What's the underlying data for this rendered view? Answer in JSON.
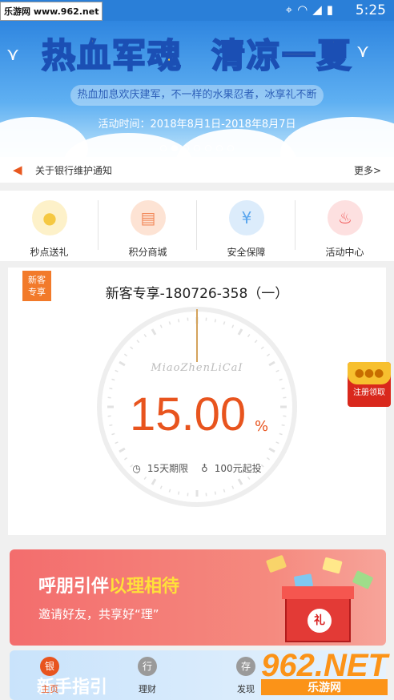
{
  "statusbar": {
    "watermark": "乐游网 www.962.net",
    "time": "5:25",
    "icons": [
      "location-icon",
      "wifi-icon",
      "signal-icon",
      "battery-icon"
    ]
  },
  "banner": {
    "title_left": "热血军魂",
    "title_right": "清凉一夏",
    "subtitle": "热血加息欢庆建军，不一样的水果忍者，冰享礼不断",
    "date": "活动时间：2018年8月1日-2018年8月7日",
    "slide_count": 7,
    "active_slide": 2
  },
  "notice": {
    "text": "关于银行维护通知",
    "more": "更多>"
  },
  "menu": {
    "items": [
      {
        "label": "秒点送礼",
        "icon": "piggy-bank-icon",
        "color": "#f5c842",
        "bg": "#fdf1c9"
      },
      {
        "label": "积分商城",
        "icon": "shop-icon",
        "color": "#f2895a",
        "bg": "#fde3d4"
      },
      {
        "label": "安全保障",
        "icon": "shield-yen-icon",
        "color": "#5aa6ee",
        "bg": "#dcecfb"
      },
      {
        "label": "活动中心",
        "icon": "flame-icon",
        "color": "#f05454",
        "bg": "#fde0e0"
      }
    ]
  },
  "product": {
    "tag_line1": "新客",
    "tag_line2": "专享",
    "name": "新客专享-180726-358（一）",
    "brand": "MiaoZhenLiCaI",
    "rate": "15.00",
    "rate_unit": "%",
    "term": "15天期限",
    "min_invest": "100元起投",
    "accent": "#e8541e"
  },
  "redpack": {
    "label": "注册领取"
  },
  "invite": {
    "heading_white": "呼朋引伴",
    "heading_yellow": "以理相待",
    "subtitle": "邀请好友，共享好“理”",
    "gift_char": "礼"
  },
  "guide": {
    "title": "新手指引"
  },
  "tabbar": {
    "tabs": [
      {
        "label": "主页",
        "icon_char": "银",
        "active": true
      },
      {
        "label": "理财",
        "icon_char": "行",
        "active": false
      },
      {
        "label": "发现",
        "icon_char": "存",
        "active": false
      }
    ]
  },
  "footer_watermark": {
    "main": "962.NET",
    "sub": "乐游网"
  }
}
